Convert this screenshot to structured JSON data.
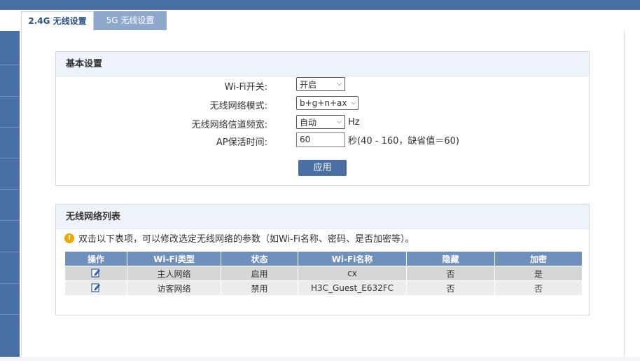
{
  "tabs": [
    {
      "label": "2.4G 无线设置",
      "active": true
    },
    {
      "label": "5G 无线设置",
      "active": false
    }
  ],
  "basic": {
    "title": "基本设置",
    "wifi_switch": {
      "label": "Wi-Fi开关:",
      "value": "开启"
    },
    "mode": {
      "label": "无线网络模式:",
      "value": "b+g+n+ax"
    },
    "bandwidth": {
      "label": "无线网络信道频宽:",
      "value": "自动",
      "unit": "Hz"
    },
    "ap_keepalive": {
      "label": "AP保活时间:",
      "value": "60",
      "hint": "秒(40 - 160，缺省值＝60)"
    },
    "apply_label": "应用"
  },
  "wlist": {
    "title": "无线网络列表",
    "hint": "双击以下表项，可以修改选定无线网络的参数（如Wi-Fi名称、密码、是否加密等）。",
    "columns": [
      "操作",
      "Wi-Fi类型",
      "状态",
      "Wi-Fi名称",
      "隐藏",
      "加密"
    ],
    "rows": [
      {
        "type": "主人网络",
        "status": "启用",
        "name": "cx",
        "hidden": "否",
        "encrypted": "是"
      },
      {
        "type": "访客网络",
        "status": "禁用",
        "name": "H3C_Guest_E632FC",
        "hidden": "否",
        "encrypted": "否"
      }
    ]
  },
  "colors": {
    "accent": "#4a6fa5",
    "header": "#6f8fbd",
    "warn": "#f0a500"
  }
}
